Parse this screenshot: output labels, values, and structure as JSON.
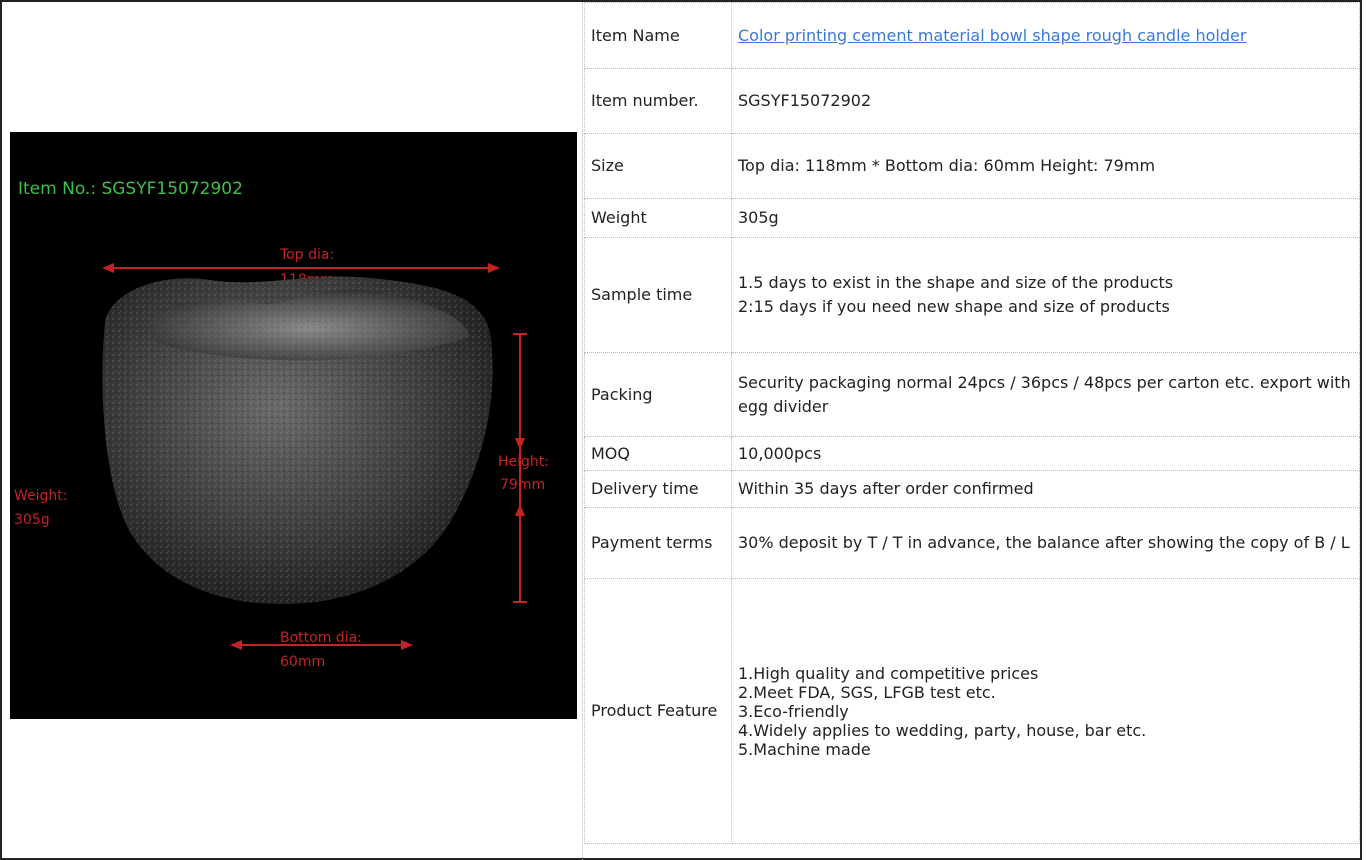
{
  "image": {
    "item_no_label": "Item No.: SGSYF15072902",
    "top_dia_label": "Top dia:",
    "top_dia_value": "118mm",
    "height_label": "Height:",
    "height_value": "79mm",
    "weight_label": "Weight:",
    "weight_value": "305g",
    "bottom_dia_label": "Bottom dia:",
    "bottom_dia_value": "60mm"
  },
  "specs": {
    "item_name_key": "Item Name",
    "item_name_value": "Color printing cement material bowl shape rough candle holder",
    "item_number_key": "Item number.",
    "item_number_value": "SGSYF15072902",
    "size_key": "Size",
    "size_value": "Top dia: 118mm * Bottom dia: 60mm Height: 79mm",
    "weight_key": "Weight",
    "weight_value": "305g",
    "sample_time_key": "Sample time",
    "sample_time_lines": [
      "1.5 days to exist in the shape and size of the products",
      "2:15 days if you need new shape and size of products"
    ],
    "packing_key": "Packing",
    "packing_value": "Security packaging normal 24pcs / 36pcs / 48pcs per carton etc. export with egg divider",
    "moq_key": "MOQ",
    "moq_value": "10,000pcs",
    "delivery_key": "Delivery time",
    "delivery_value": "Within 35 days after order confirmed",
    "payment_key": "Payment terms",
    "payment_value": "30% deposit by T / T in advance, the balance after showing the copy of B / L",
    "feature_key": "Product Feature",
    "feature_lines": [
      "1.High quality and competitive prices",
      "2.Meet FDA, SGS, LFGB test etc.",
      "3.Eco-friendly",
      "4.Widely applies to wedding, party, house, bar etc.",
      "5.Machine made"
    ]
  },
  "colors": {
    "link": "#3a78d6",
    "image_label_green": "#3fbf4a",
    "image_label_red": "#c42323"
  }
}
